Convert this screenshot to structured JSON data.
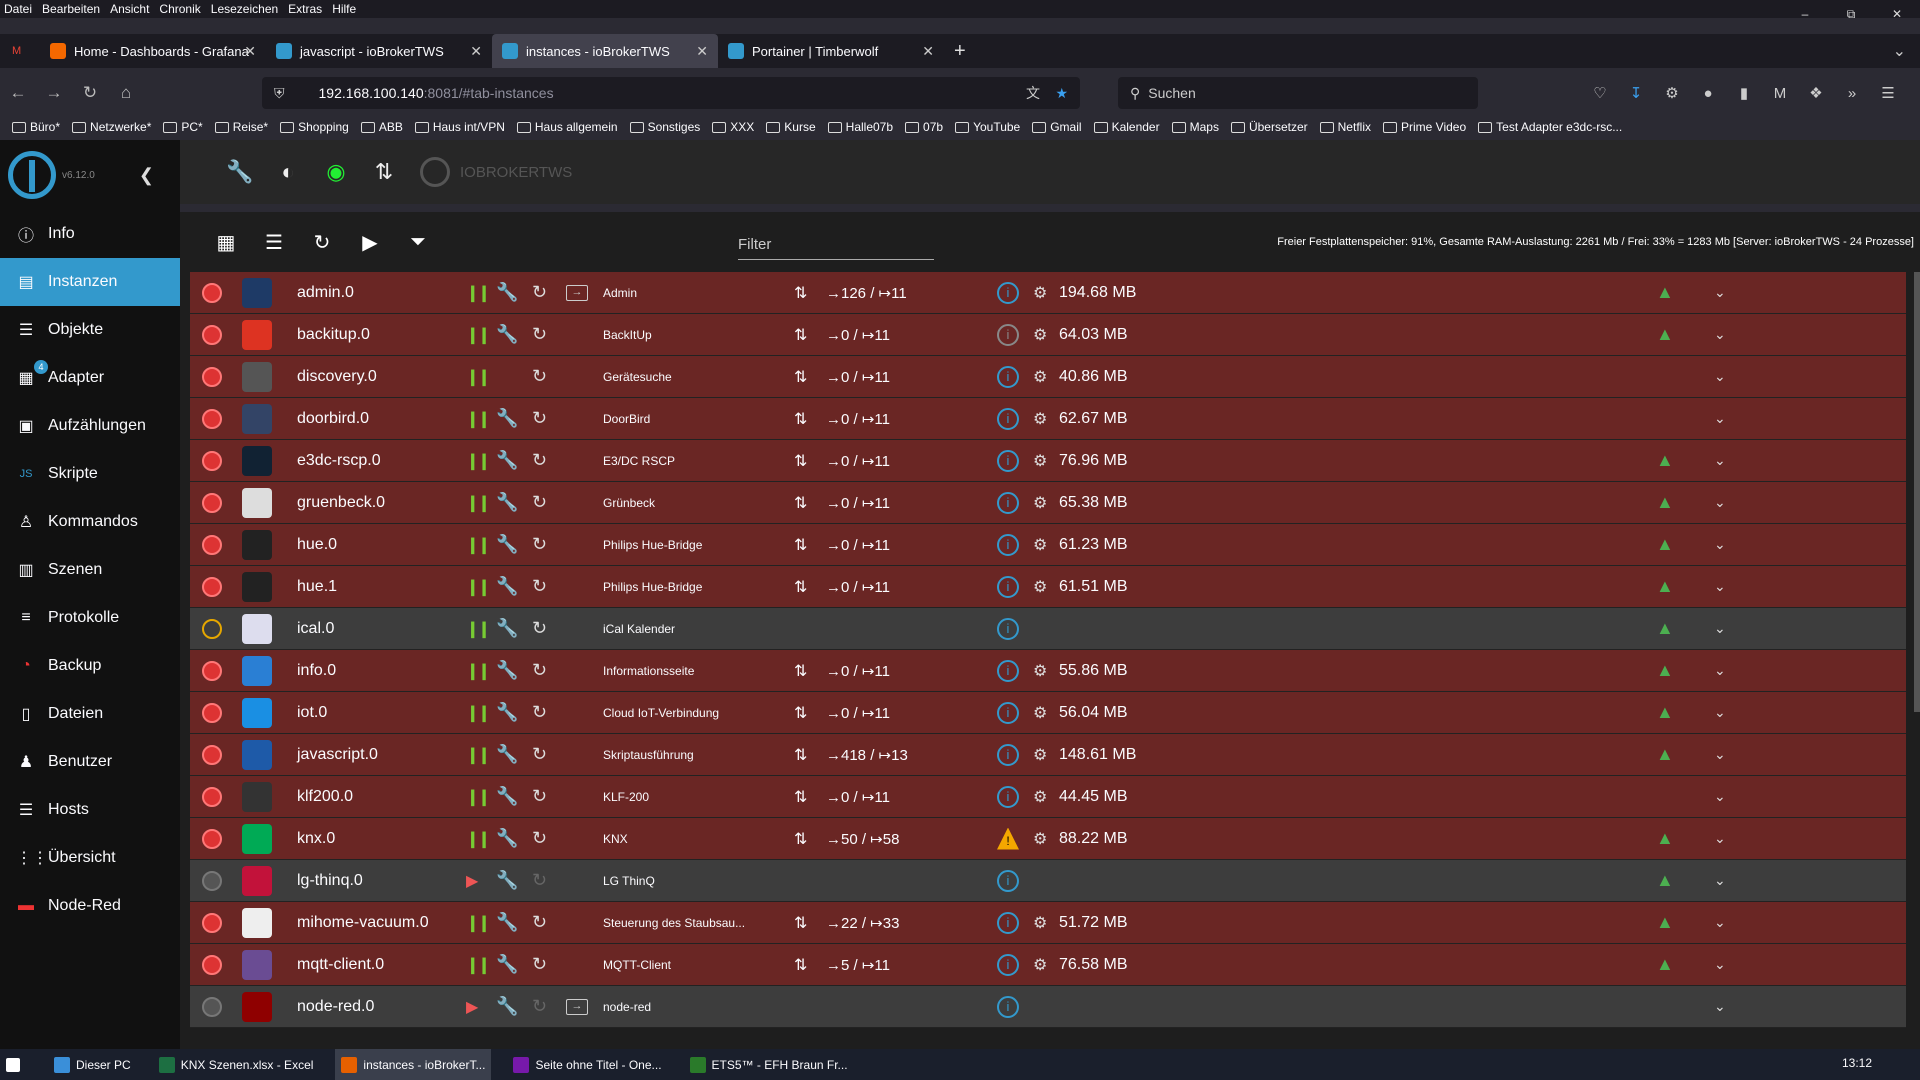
{
  "menu": [
    "Datei",
    "Bearbeiten",
    "Ansicht",
    "Chronik",
    "Lesezeichen",
    "Extras",
    "Hilfe"
  ],
  "tabs": [
    {
      "label": "Home - Dashboards - Grafana",
      "icon": "grafana-icon"
    },
    {
      "label": "javascript - ioBrokerTWS",
      "icon": "iobroker-icon"
    },
    {
      "label": "instances - ioBrokerTWS",
      "icon": "iobroker-icon",
      "active": true
    },
    {
      "label": "Portainer | Timberwolf",
      "icon": "portainer-icon"
    }
  ],
  "url": {
    "host": "192.168.100.140",
    "rest": ":8081/#tab-instances"
  },
  "search_placeholder": "Suchen",
  "bookmarks": [
    "Büro*",
    "Netzwerke*",
    "PC*",
    "Reise*",
    "Shopping",
    "ABB",
    "Haus int/VPN",
    "Haus allgemein",
    "Sonstiges",
    "XXX",
    "Kurse",
    "Halle07b",
    "07b",
    "YouTube",
    "Gmail",
    "Kalender",
    "Maps",
    "Übersetzer",
    "Netflix",
    "Prime Video",
    "Test Adapter e3dc-rsc..."
  ],
  "app": {
    "version": "v6.12.0",
    "brand": "IOBROKERTWS"
  },
  "sidebar": [
    {
      "label": "Info",
      "icon": "info-icon"
    },
    {
      "label": "Instanzen",
      "icon": "instances-icon",
      "active": true
    },
    {
      "label": "Objekte",
      "icon": "objects-icon"
    },
    {
      "label": "Adapter",
      "icon": "adapter-icon",
      "badge": "4"
    },
    {
      "label": "Aufzählungen",
      "icon": "enums-icon"
    },
    {
      "label": "Skripte",
      "icon": "scripts-icon"
    },
    {
      "label": "Kommandos",
      "icon": "commands-icon"
    },
    {
      "label": "Szenen",
      "icon": "scenes-icon"
    },
    {
      "label": "Protokolle",
      "icon": "logs-icon"
    },
    {
      "label": "Backup",
      "icon": "backup-icon"
    },
    {
      "label": "Dateien",
      "icon": "files-icon"
    },
    {
      "label": "Benutzer",
      "icon": "user-icon"
    },
    {
      "label": "Hosts",
      "icon": "hosts-icon"
    },
    {
      "label": "Übersicht",
      "icon": "grid-icon"
    },
    {
      "label": "Node-Red",
      "icon": "nodered-icon"
    }
  ],
  "filter_label": "Filter",
  "sysinfo": "Freier Festplattenspeicher: 91%, Gesamte RAM-Auslastung: 2261 Mb / Frei: 33% = 1283 Mb [Server: ioBrokerTWS - 24 Prozesse]",
  "instances": [
    {
      "name": "admin.0",
      "title": "Admin",
      "events": "→126 / ↦11",
      "mem": "194.68 MB",
      "state": "red",
      "run": "pause",
      "icon_color": "#1e3a66"
    },
    {
      "name": "backitup.0",
      "title": "BackItUp",
      "events": "→0 / ↦11",
      "mem": "64.03 MB",
      "state": "red",
      "run": "pause",
      "icon_color": "#d32"
    },
    {
      "name": "discovery.0",
      "title": "Gerätesuche",
      "events": "→0 / ↦11",
      "mem": "40.86 MB",
      "state": "red",
      "run": "pause",
      "icon_color": "#555"
    },
    {
      "name": "doorbird.0",
      "title": "DoorBird",
      "events": "→0 / ↦11",
      "mem": "62.67 MB",
      "state": "red",
      "run": "pause",
      "icon_color": "#346"
    },
    {
      "name": "e3dc-rscp.0",
      "title": "E3/DC RSCP",
      "events": "→0 / ↦11",
      "mem": "76.96 MB",
      "state": "red",
      "run": "pause",
      "icon_color": "#123"
    },
    {
      "name": "gruenbeck.0",
      "title": "Grünbeck",
      "events": "→0 / ↦11",
      "mem": "65.38 MB",
      "state": "red",
      "run": "pause",
      "icon_color": "#ddd"
    },
    {
      "name": "hue.0",
      "title": "Philips Hue-Bridge",
      "events": "→0 / ↦11",
      "mem": "61.23 MB",
      "state": "red",
      "run": "pause",
      "icon_color": "#222"
    },
    {
      "name": "hue.1",
      "title": "Philips Hue-Bridge",
      "events": "→0 / ↦11",
      "mem": "61.51 MB",
      "state": "red",
      "run": "pause",
      "icon_color": "#222"
    },
    {
      "name": "ical.0",
      "title": "iCal Kalender",
      "events": "",
      "mem": "",
      "state": "yellow",
      "run": "pause",
      "icon_color": "#dde"
    },
    {
      "name": "info.0",
      "title": "Informationsseite",
      "events": "→0 / ↦11",
      "mem": "55.86 MB",
      "state": "red",
      "run": "pause",
      "icon_color": "#2a7fd4"
    },
    {
      "name": "iot.0",
      "title": "Cloud IoT-Verbindung",
      "events": "→0 / ↦11",
      "mem": "56.04 MB",
      "state": "red",
      "run": "pause",
      "icon_color": "#1a8fe3"
    },
    {
      "name": "javascript.0",
      "title": "Skriptausführung",
      "events": "→418 / ↦13",
      "mem": "148.61 MB",
      "state": "red",
      "run": "pause",
      "icon_color": "#1e5aa8"
    },
    {
      "name": "klf200.0",
      "title": "KLF-200",
      "events": "→0 / ↦11",
      "mem": "44.45 MB",
      "state": "red",
      "run": "pause",
      "icon_color": "#333"
    },
    {
      "name": "knx.0",
      "title": "KNX",
      "events": "→50 / ↦58",
      "mem": "88.22 MB",
      "state": "red",
      "run": "pause",
      "icon_color": "#0a5"
    },
    {
      "name": "lg-thinq.0",
      "title": "LG ThinQ",
      "events": "",
      "mem": "",
      "state": "grey",
      "run": "play",
      "icon_color": "#c2123a"
    },
    {
      "name": "mihome-vacuum.0",
      "title": "Steuerung des Staubsau...",
      "events": "→22 / ↦33",
      "mem": "51.72 MB",
      "state": "red",
      "run": "pause",
      "icon_color": "#eee"
    },
    {
      "name": "mqtt-client.0",
      "title": "MQTT-Client",
      "events": "→5 / ↦11",
      "mem": "76.58 MB",
      "state": "red",
      "run": "pause",
      "icon_color": "#6a4c93"
    },
    {
      "name": "node-red.0",
      "title": "node-red",
      "events": "",
      "mem": "",
      "state": "grey",
      "run": "play",
      "icon_color": "#8f0000"
    }
  ],
  "taskbar": [
    {
      "label": "Dieser PC"
    },
    {
      "label": "KNX Szenen.xlsx - Excel"
    },
    {
      "label": "instances - ioBrokerT...",
      "active": true
    },
    {
      "label": "Seite ohne Titel - One..."
    },
    {
      "label": "ETS5™ - EFH Braun Fr..."
    }
  ],
  "clock": "13:12"
}
